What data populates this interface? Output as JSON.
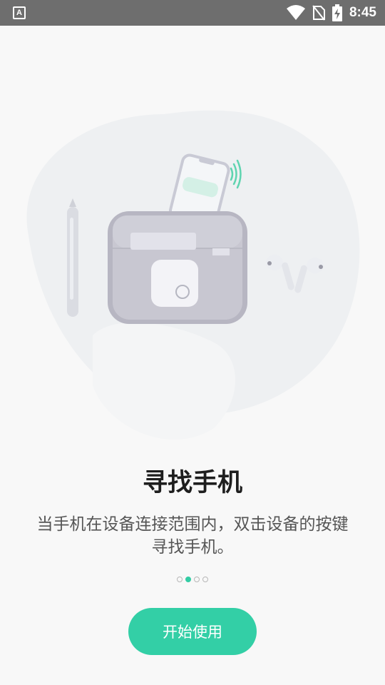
{
  "status_bar": {
    "app_icon_letter": "A",
    "time": "8:45",
    "icons": [
      "wifi-icon",
      "no-sim-icon",
      "battery-charging-icon"
    ]
  },
  "onboarding": {
    "title": "寻找手机",
    "description": "当手机在设备连接范围内，双击设备的按键寻找手机。",
    "page_count": 4,
    "active_page": 2,
    "start_button_label": "开始使用"
  },
  "colors": {
    "accent": "#33cfa6",
    "status_bar": "#6e6e6e",
    "background": "#f8f8f8"
  }
}
